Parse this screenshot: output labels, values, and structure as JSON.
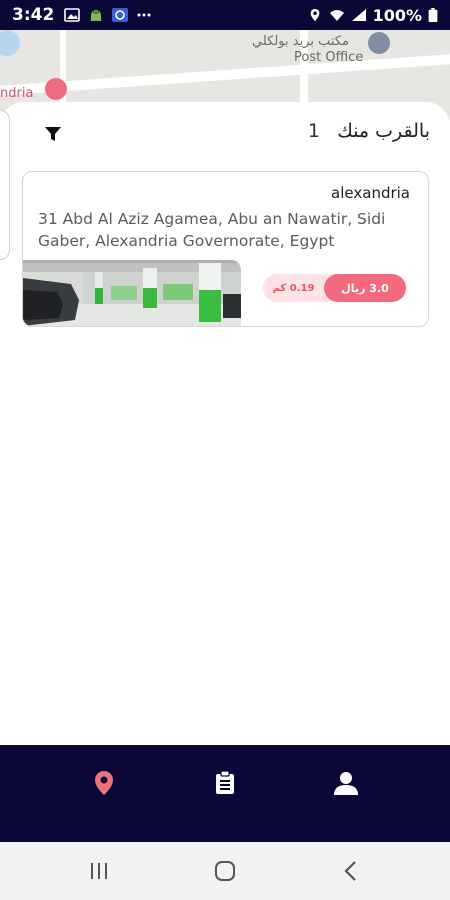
{
  "status_bar": {
    "time": "3:42",
    "battery": "100%",
    "icons": [
      "image-icon",
      "android-icon",
      "app-icon",
      "more-icon",
      "location-icon",
      "wifi-icon",
      "signal-icon",
      "battery-icon"
    ]
  },
  "map": {
    "labels": [
      "مكتب بريد بولكلي",
      "Post Office",
      "ndria"
    ]
  },
  "header": {
    "title": "بالقرب منك",
    "count": "1"
  },
  "card": {
    "name": "alexandria",
    "address": "31 Abd Al Aziz Agamea, Abu an Nawatir, Sidi Gaber, Alexandria Governorate, Egypt",
    "price": "3.0 ريال",
    "distance": "0.19 كم"
  },
  "bottom_nav": {
    "items": [
      "map-pin-icon",
      "clipboard-icon",
      "user-icon"
    ],
    "active_color": "#f0727f",
    "color": "#ffffff"
  },
  "android_nav": [
    "recent-apps-icon",
    "home-icon",
    "back-icon"
  ],
  "colors": {
    "primary_dark": "#0b0736",
    "accent": "#f26a7b",
    "accent_light": "#fde3e6"
  }
}
